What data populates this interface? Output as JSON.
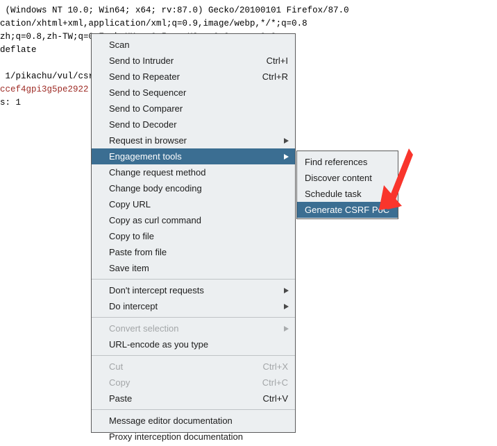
{
  "background": {
    "lines": [
      {
        "text": " (Windows NT 10.0; Win64; x64; rv:87.0) Gecko/20100101 Firefox/87.0",
        "color": "black"
      },
      {
        "text": "cation/xhtml+xml,application/xml;q=0.9,image/webp,*/*;q=0.8",
        "color": "black"
      },
      {
        "text": "zh;q=0.8,zh-TW;q=0.7,zh-HK;q=0.5,en-US;q=0.3,en;q=0.2",
        "color": "black"
      },
      {
        "text": "deflate",
        "color": "black"
      },
      {
        "text": "",
        "color": "black"
      },
      {
        "text": " 1/pikachu/vul/csrf/csrfget/csrf_get_edit.php",
        "color": "black"
      },
      {
        "text": "ccef4gpi3g5pe2922",
        "color": "red"
      },
      {
        "text": "s: 1",
        "color": "black"
      }
    ],
    "text_color": "#000000",
    "highlight_color": "#9e2b25"
  },
  "context_menu": {
    "name": "burp-request-context-menu",
    "highlight_color": "#3b6e92",
    "background_color": "#eceff1",
    "groups": [
      {
        "items": [
          {
            "label": "Scan",
            "accel": "",
            "submenu": false,
            "disabled": false,
            "selected": false
          },
          {
            "label": "Send to Intruder",
            "accel": "Ctrl+I",
            "submenu": false,
            "disabled": false,
            "selected": false
          },
          {
            "label": "Send to Repeater",
            "accel": "Ctrl+R",
            "submenu": false,
            "disabled": false,
            "selected": false
          },
          {
            "label": "Send to Sequencer",
            "accel": "",
            "submenu": false,
            "disabled": false,
            "selected": false
          },
          {
            "label": "Send to Comparer",
            "accel": "",
            "submenu": false,
            "disabled": false,
            "selected": false
          },
          {
            "label": "Send to Decoder",
            "accel": "",
            "submenu": false,
            "disabled": false,
            "selected": false
          },
          {
            "label": "Request in browser",
            "accel": "",
            "submenu": true,
            "disabled": false,
            "selected": false
          },
          {
            "label": "Engagement tools",
            "accel": "",
            "submenu": true,
            "disabled": false,
            "selected": true
          },
          {
            "label": "Change request method",
            "accel": "",
            "submenu": false,
            "disabled": false,
            "selected": false
          },
          {
            "label": "Change body encoding",
            "accel": "",
            "submenu": false,
            "disabled": false,
            "selected": false
          },
          {
            "label": "Copy URL",
            "accel": "",
            "submenu": false,
            "disabled": false,
            "selected": false
          },
          {
            "label": "Copy as curl command",
            "accel": "",
            "submenu": false,
            "disabled": false,
            "selected": false
          },
          {
            "label": "Copy to file",
            "accel": "",
            "submenu": false,
            "disabled": false,
            "selected": false
          },
          {
            "label": "Paste from file",
            "accel": "",
            "submenu": false,
            "disabled": false,
            "selected": false
          },
          {
            "label": "Save item",
            "accel": "",
            "submenu": false,
            "disabled": false,
            "selected": false
          }
        ]
      },
      {
        "items": [
          {
            "label": "Don't intercept requests",
            "accel": "",
            "submenu": true,
            "disabled": false,
            "selected": false
          },
          {
            "label": "Do intercept",
            "accel": "",
            "submenu": true,
            "disabled": false,
            "selected": false
          }
        ]
      },
      {
        "items": [
          {
            "label": "Convert selection",
            "accel": "",
            "submenu": true,
            "disabled": true,
            "selected": false
          },
          {
            "label": "URL-encode as you type",
            "accel": "",
            "submenu": false,
            "disabled": false,
            "selected": false
          }
        ]
      },
      {
        "items": [
          {
            "label": "Cut",
            "accel": "Ctrl+X",
            "submenu": false,
            "disabled": true,
            "selected": false
          },
          {
            "label": "Copy",
            "accel": "Ctrl+C",
            "submenu": false,
            "disabled": true,
            "selected": false
          },
          {
            "label": "Paste",
            "accel": "Ctrl+V",
            "submenu": false,
            "disabled": false,
            "selected": false
          }
        ]
      },
      {
        "items": [
          {
            "label": "Message editor documentation",
            "accel": "",
            "submenu": false,
            "disabled": false,
            "selected": false
          },
          {
            "label": "Proxy interception documentation",
            "accel": "",
            "submenu": false,
            "disabled": false,
            "selected": false
          }
        ]
      }
    ]
  },
  "submenu": {
    "name": "engagement-tools-submenu",
    "items": [
      {
        "label": "Find references",
        "accel": "",
        "submenu": false,
        "disabled": false,
        "selected": false
      },
      {
        "label": "Discover content",
        "accel": "",
        "submenu": false,
        "disabled": false,
        "selected": false
      },
      {
        "label": "Schedule task",
        "accel": "",
        "submenu": false,
        "disabled": false,
        "selected": false
      },
      {
        "label": "Generate CSRF PoC",
        "accel": "",
        "submenu": false,
        "disabled": false,
        "selected": true
      }
    ]
  },
  "annotation": {
    "name": "red-pointer-arrow",
    "color": "#f9352c",
    "points_to": "Generate CSRF PoC"
  }
}
